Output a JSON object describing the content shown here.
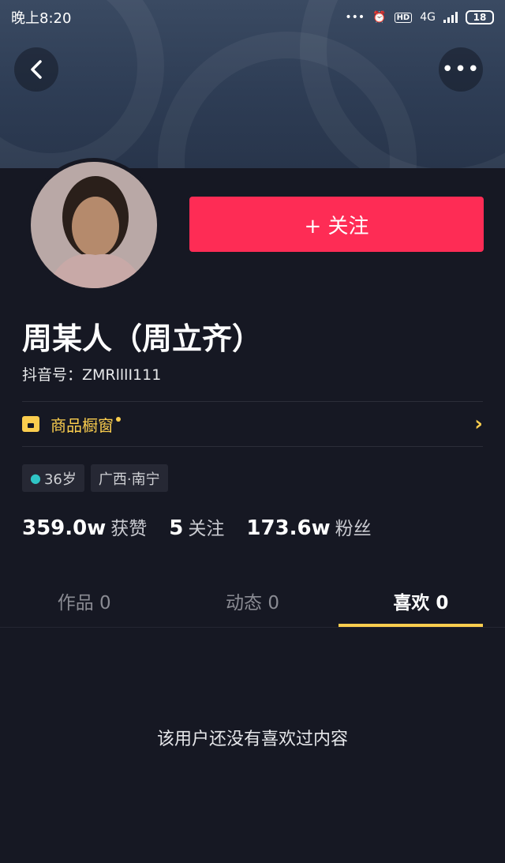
{
  "status_bar": {
    "time": "晚上8:20",
    "network": "4G",
    "hd": "HD",
    "battery": "18"
  },
  "profile": {
    "follow_label": "+ 关注",
    "name": "周某人（周立齐）",
    "douyin_id": "抖音号：ZMRlllI111",
    "shop_label": "商品橱窗",
    "tags": [
      {
        "label": "36岁",
        "icon": "person-icon"
      },
      {
        "label": "广西·南宁"
      }
    ],
    "stats": [
      {
        "value": "359.0w",
        "label": "获赞"
      },
      {
        "value": "5",
        "label": "关注"
      },
      {
        "value": "173.6w",
        "label": "粉丝"
      }
    ]
  },
  "tabs": [
    {
      "label": "作品 0",
      "active": false
    },
    {
      "label": "动态 0",
      "active": false
    },
    {
      "label": "喜欢 0",
      "active": true
    }
  ],
  "empty_message": "该用户还没有喜欢过内容",
  "colors": {
    "accent": "#fe2c55",
    "highlight": "#facd4e",
    "background": "#161823"
  }
}
